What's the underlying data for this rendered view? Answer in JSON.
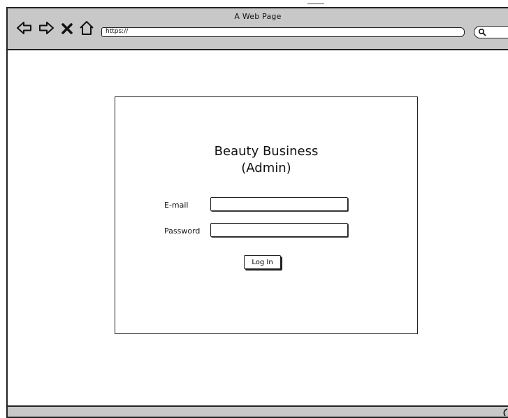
{
  "browser": {
    "title": "A Web Page",
    "url": "https://",
    "icons": {
      "back": "back-arrow-icon",
      "forward": "forward-arrow-icon",
      "stop": "close-icon",
      "home": "home-icon",
      "search": "search-icon"
    }
  },
  "login": {
    "title_line1": "Beauty Business",
    "title_line2": "(Admin)",
    "email_label": "E-mail",
    "email_value": "",
    "password_label": "Password",
    "password_value": "",
    "submit_label": "Log In"
  },
  "colors": {
    "chrome": "#c8c8c8",
    "stroke": "#222222",
    "background": "#ffffff"
  }
}
